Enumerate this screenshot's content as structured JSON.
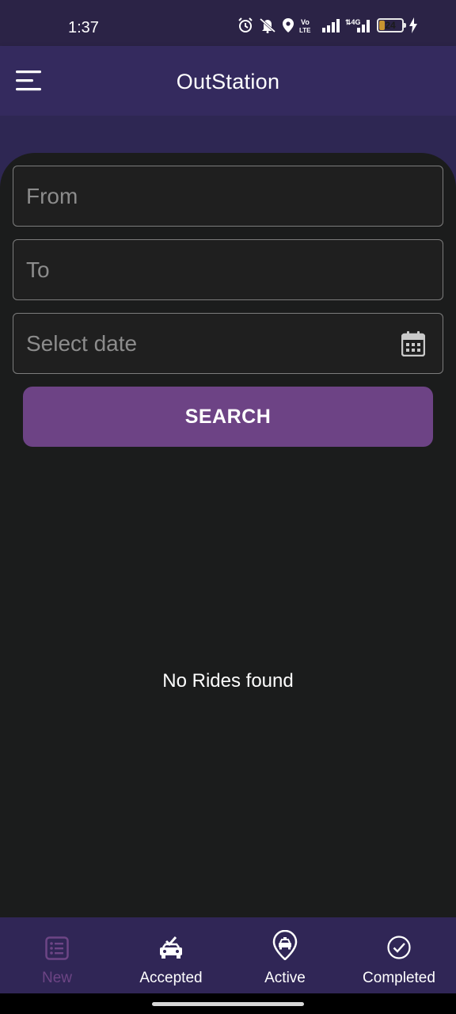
{
  "status_bar": {
    "time": "1:37",
    "battery_level": "24",
    "battery_fraction": 0.24,
    "icons": [
      "alarm-icon",
      "mute-icon",
      "location-icon",
      "volte-icon",
      "signal-icon",
      "4g-signal-icon",
      "battery-icon",
      "charging-icon"
    ]
  },
  "app_bar": {
    "title": "OutStation",
    "menu_icon": "hamburger-menu-icon"
  },
  "form": {
    "from_placeholder": "From",
    "to_placeholder": "To",
    "date_placeholder": "Select date",
    "search_label": "SEARCH"
  },
  "results": {
    "empty_text": "No Rides found"
  },
  "bottom_nav": {
    "items": [
      {
        "label": "New",
        "icon": "list-icon",
        "active": true
      },
      {
        "label": "Accepted",
        "icon": "taxi-check-icon",
        "active": false
      },
      {
        "label": "Active",
        "icon": "taxi-location-icon",
        "active": false
      },
      {
        "label": "Completed",
        "icon": "check-circle-icon",
        "active": false
      }
    ]
  },
  "colors": {
    "app_bar": "#342a5e",
    "status_bar": "#2b2346",
    "background": "#1b1c1c",
    "accent": "#6d4385",
    "nav_bar": "#302656",
    "field_border": "#7c7c7c",
    "placeholder": "#8c8c8c"
  }
}
